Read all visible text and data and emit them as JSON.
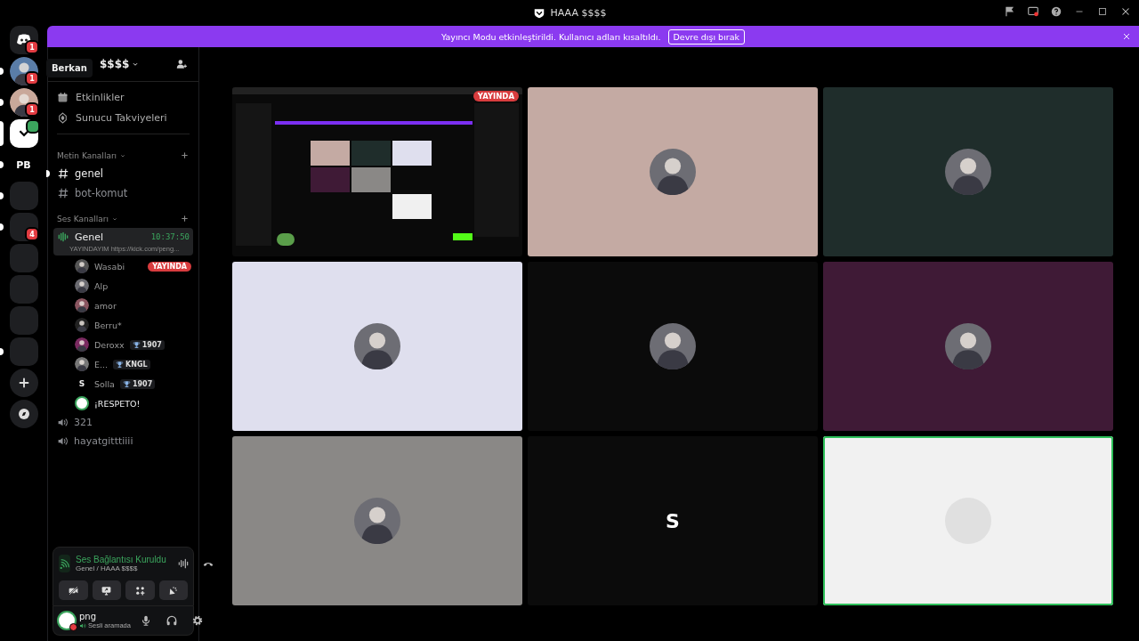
{
  "window": {
    "title": "HAAA $$$$"
  },
  "banner": {
    "message": "Yayıncı Modu etkinleştirildi. Kullanıcı adları kısaltıldı.",
    "button": "Devre dışı bırak"
  },
  "tooltip": "Berkan",
  "servers": [
    {
      "kind": "home",
      "badge": "1",
      "selected": false,
      "unread": false
    },
    {
      "kind": "avatar",
      "badge": "1",
      "selected": false,
      "unread": true,
      "color": "#5a7da8"
    },
    {
      "kind": "avatar",
      "badge": "1",
      "selected": false,
      "unread": true,
      "color": "#c9a89a"
    },
    {
      "kind": "server",
      "selected": true,
      "unread": false,
      "voice": true
    },
    {
      "kind": "server",
      "label": "PB",
      "selected": false,
      "unread": true
    },
    {
      "kind": "group",
      "selected": false,
      "unread": true
    },
    {
      "kind": "group",
      "badge": "4",
      "selected": false,
      "unread": true
    },
    {
      "kind": "group",
      "selected": false,
      "unread": false
    },
    {
      "kind": "group",
      "selected": false,
      "unread": false
    },
    {
      "kind": "group",
      "selected": false,
      "unread": false
    },
    {
      "kind": "group",
      "selected": false,
      "unread": true
    },
    {
      "kind": "add",
      "selected": false,
      "unread": false
    },
    {
      "kind": "discover",
      "selected": false,
      "unread": false
    }
  ],
  "guild": {
    "name": "$$$$"
  },
  "nav_items": [
    {
      "kind": "events",
      "label": "Etkinlikler"
    },
    {
      "kind": "boost",
      "label": "Sunucu Takviyeleri"
    }
  ],
  "categories": [
    {
      "name": "Metin Kanalları",
      "channels": [
        {
          "kind": "text",
          "name": "genel",
          "unread": true
        },
        {
          "kind": "text",
          "name": "bot-komut",
          "unread": false
        }
      ]
    },
    {
      "name": "Ses Kanalları",
      "channels": [
        {
          "kind": "voice",
          "name": "Genel",
          "connected": true,
          "time": "10:37:50",
          "status": "YAYINDAYIM https://kick.com/peng...",
          "members": [
            {
              "name": "Wasabi",
              "live": "YAYINDA",
              "speaking": false
            },
            {
              "name": "Alp",
              "speaking": false
            },
            {
              "name": "amor",
              "speaking": false
            },
            {
              "name": "Berru*",
              "speaking": false
            },
            {
              "name": "Deroxx",
              "tag": "1907",
              "speaking": false
            },
            {
              "name": "E...",
              "tag": "KNGL",
              "speaking": false
            },
            {
              "name": "Solla",
              "initial": "S",
              "tag": "1907",
              "speaking": false
            },
            {
              "name": "¡RESPETO!",
              "speaking": true
            }
          ]
        },
        {
          "kind": "voice",
          "name": "321",
          "connected": false
        },
        {
          "kind": "voice",
          "name": "hayatgitttiiii",
          "connected": false
        }
      ]
    }
  ],
  "voice_panel": {
    "title": "Ses Bağlantısı Kuruldu",
    "subtitle": "Genel / HAAA $$$$"
  },
  "user": {
    "name": "png",
    "status": "Sesli aramada"
  },
  "tiles": [
    {
      "kind": "stream",
      "color": "#000000",
      "live": "YAYINDA",
      "speaking": false
    },
    {
      "kind": "avatar",
      "color": "#c4aaa3",
      "speaking": false
    },
    {
      "kind": "avatar",
      "color": "#1f2d2b",
      "speaking": false
    },
    {
      "kind": "avatar",
      "color": "#dfdfee",
      "speaking": false
    },
    {
      "kind": "avatar",
      "color": "#0b0b0b",
      "speaking": false
    },
    {
      "kind": "avatar",
      "color": "#3f1a36",
      "speaking": false
    },
    {
      "kind": "avatar",
      "color": "#8a8886",
      "speaking": false
    },
    {
      "kind": "letter",
      "color": "#0b0b0b",
      "initial": "S",
      "speaking": false
    },
    {
      "kind": "avatar",
      "color": "#f1f1f1",
      "speaking": true
    }
  ]
}
